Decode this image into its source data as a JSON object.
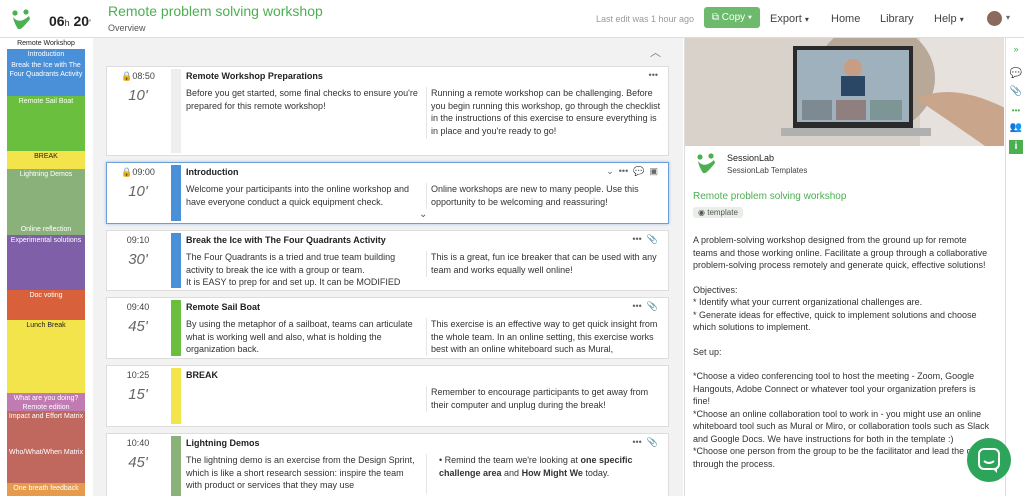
{
  "header": {
    "duration_hours": "06",
    "duration_h": "h",
    "duration_minutes": "20",
    "duration_m": "'",
    "title": "Remote problem solving workshop",
    "subtitle": "Overview",
    "last_edit": "Last edit was 1 hour ago",
    "copy_label": "Copy",
    "export_label": "Export",
    "home_label": "Home",
    "library_label": "Library",
    "help_label": "Help"
  },
  "timeline": [
    {
      "label": "Remote Workshop",
      "color": "#ffffff"
    },
    {
      "label": "Introduction",
      "color": "#4a90d9"
    },
    {
      "label": "Break the Ice with The Four Quadrants Activity",
      "color": "#4a90d9"
    },
    {
      "label": "Remote Sail Boat",
      "color": "#6bbf3f"
    },
    {
      "label": "BREAK",
      "color": "#f3e44c"
    },
    {
      "label": "Lightning Demos",
      "color": "#8bb17b"
    },
    {
      "label": "Online reflection",
      "color": "#8bb17b"
    },
    {
      "label": "Experimental solutions",
      "color": "#7e5fa8"
    },
    {
      "label": "Doc voting",
      "color": "#d8613c"
    },
    {
      "label": "Lunch Break",
      "color": "#f3e44c"
    },
    {
      "label": "What are you doing? Remote edition",
      "color": "#c07bb3"
    },
    {
      "label": "Impact and Effort Matrix",
      "color": "#c0675e"
    },
    {
      "label": "Who/What/When Matrix",
      "color": "#c0675e"
    },
    {
      "label": "One breath feedback",
      "color": "#e59a4c"
    }
  ],
  "blocks": [
    {
      "time": "08:50",
      "duration": "10'",
      "title": "Remote Workshop Preparations",
      "bar_color": "#eeeeee",
      "desc": "Before you get started, some final checks to ensure you're prepared for this remote workshop!",
      "notes": "Running a remote workshop can be challenging. Before you begin running this workshop, go through the checklist in the instructions of this exercise to ensure everything is in place and you're ready to go!"
    },
    {
      "time": "09:00",
      "duration": "10'",
      "title": "Introduction",
      "bar_color": "#4a90d9",
      "desc": "Welcome your participants into the online workshop and have everyone conduct a quick equipment check.",
      "notes": "Online workshops are new to many people. Use this opportunity to be welcoming and reassuring!"
    },
    {
      "time": "09:10",
      "duration": "30'",
      "title": "Break the Ice with The Four Quadrants Activity",
      "bar_color": "#4a90d9",
      "desc": "The Four Quadrants is a tried and true team building activity to break the ice with a group or team.",
      "desc2": "It is EASY to prep for and set up. It can be MODIFIED",
      "notes": "This is a great, fun ice breaker that can be used with any team and works equally well online!"
    },
    {
      "time": "09:40",
      "duration": "45'",
      "title": "Remote Sail Boat",
      "bar_color": "#6bbf3f",
      "desc": "By using the metaphor of a sailboat, teams can articulate what is working well and also, what is holding the organization back.",
      "notes": "This exercise is an effective way to get quick insight from the whole team. In an online setting, this exercise works best with an online whiteboard such as Mural,"
    },
    {
      "time": "10:25",
      "duration": "15'",
      "title": "BREAK",
      "bar_color": "#f3e44c",
      "desc": "",
      "notes": "Remember to encourage participants to get away from their computer and unplug during the break!"
    },
    {
      "time": "10:40",
      "duration": "45'",
      "title": "Lightning Demos",
      "bar_color": "#8bb17b",
      "desc": "The lightning demo is an exercise from the Design Sprint, which is like a short research session: inspire the team with product or services that they may use",
      "notes_pre": "Remind the team we're looking at ",
      "notes_bold1": "one specific challenge area",
      "notes_mid": " and ",
      "notes_bold2": "How Might We",
      "notes_post": " today."
    }
  ],
  "detail": {
    "brand": "SessionLab",
    "brand_sub": "SessionLab Templates",
    "title": "Remote problem solving workshop",
    "tag": "template",
    "p1": "A problem-solving workshop designed from the ground up for remote teams and those working online. Facilitate a group through a collaborative problem-solving process remotely and generate quick, effective solutions!",
    "p2": "Objectives:\n* Identify what your current organizational challenges are.\n* Generate ideas for effective, quick to implement solutions and choose which solutions to implement.",
    "p3": "Set up:",
    "p4": "*Choose a video conferencing tool to host the meeting - Zoom, Google Hangouts, Adobe Connect or whatever tool your organization prefers is fine!\n*Choose an online collaboration tool to work in - you might use an online whiteboard tool such as Mural or Miro, or collaboration tools such as Slack and Google Docs. We have instructions for both in the template :)\n*Choose one person from the group to be the facilitator and lead the group through the process."
  },
  "colors": {
    "accent": "#4caf50",
    "copy_button": "#6dba6d",
    "chat": "#2ca55a"
  }
}
